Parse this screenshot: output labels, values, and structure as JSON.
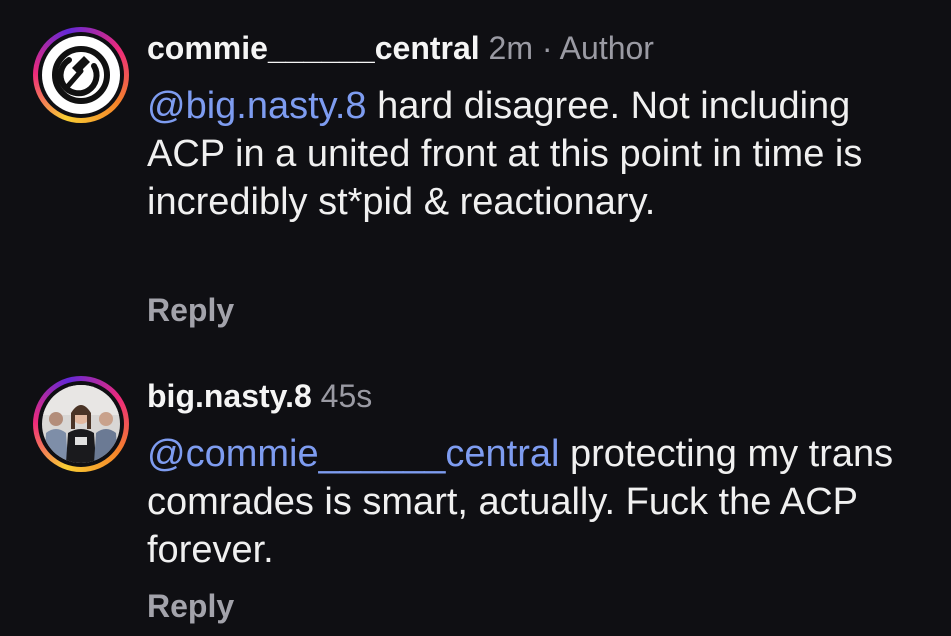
{
  "comments": [
    {
      "username": "commie______central",
      "time": "2m",
      "separator": "·",
      "badge": "Author",
      "mention": "@big.nasty.8",
      "text": " hard disagree. Not including ACP in a united front at this point in time is incredibly st*pid & reactionary.",
      "reply_label": "Reply",
      "avatar_icon": "hammer-sickle-icon"
    },
    {
      "username": "big.nasty.8",
      "time": "45s",
      "mention": "@commie______central",
      "text": " protecting my trans comrades is smart, actually. Fuck the ACP forever.",
      "reply_label": "Reply",
      "avatar_icon": "group-photo"
    }
  ],
  "colors": {
    "background": "#0f0f13",
    "mention": "#7e9cf0",
    "meta": "#9a9aa3",
    "reply": "#a3a3ab"
  }
}
